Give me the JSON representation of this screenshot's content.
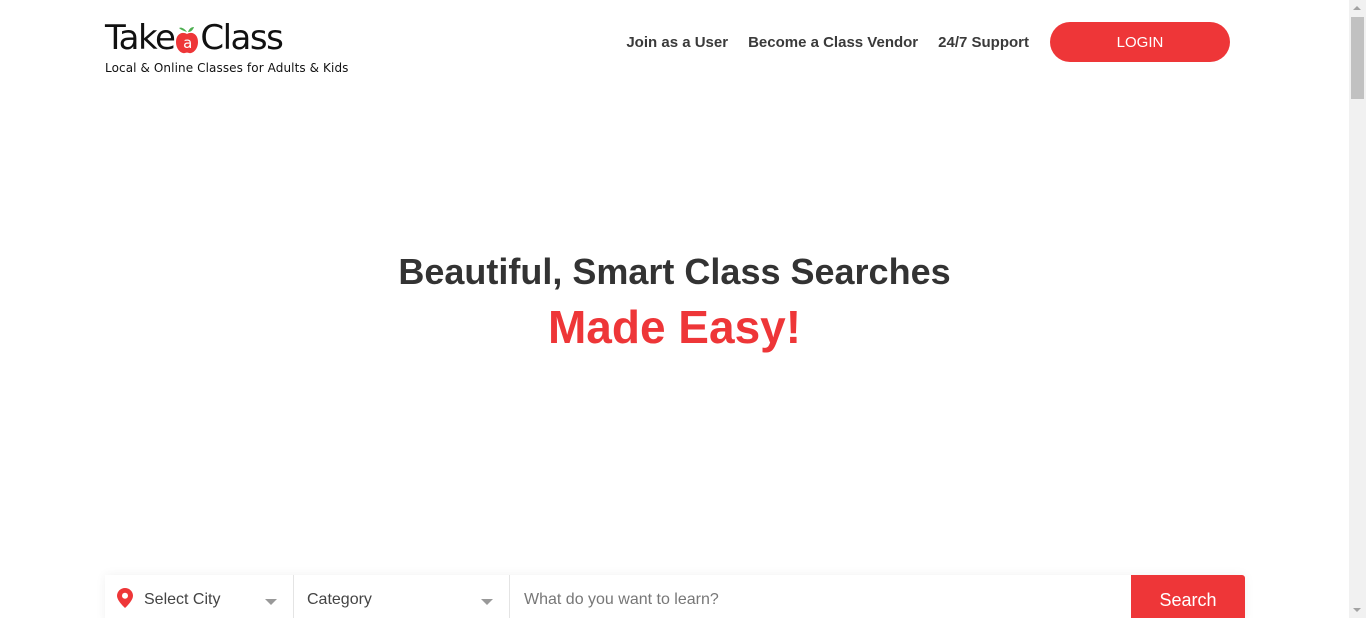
{
  "brand": {
    "logo_part1": "Take",
    "logo_apple_letter": "a",
    "logo_part2": "Class",
    "tagline": "Local & Online Classes for Adults & Kids"
  },
  "nav": {
    "join_user": "Join as a User",
    "become_vendor": "Become a Class Vendor",
    "support": "24/7 Support",
    "login": "LOGIN"
  },
  "hero": {
    "title": "Beautiful, Smart Class Searches",
    "subtitle": "Made Easy!"
  },
  "search": {
    "city_label": "Select City",
    "category_label": "Category",
    "learn_placeholder": "What do you want to learn?",
    "button_label": "Search"
  },
  "colors": {
    "accent_red": "#ee3638",
    "apple_leaf": "#4caf50",
    "text_dark": "#333333"
  },
  "icons": {
    "location": "map-pin-icon",
    "dropdown": "chevron-down-icon"
  }
}
